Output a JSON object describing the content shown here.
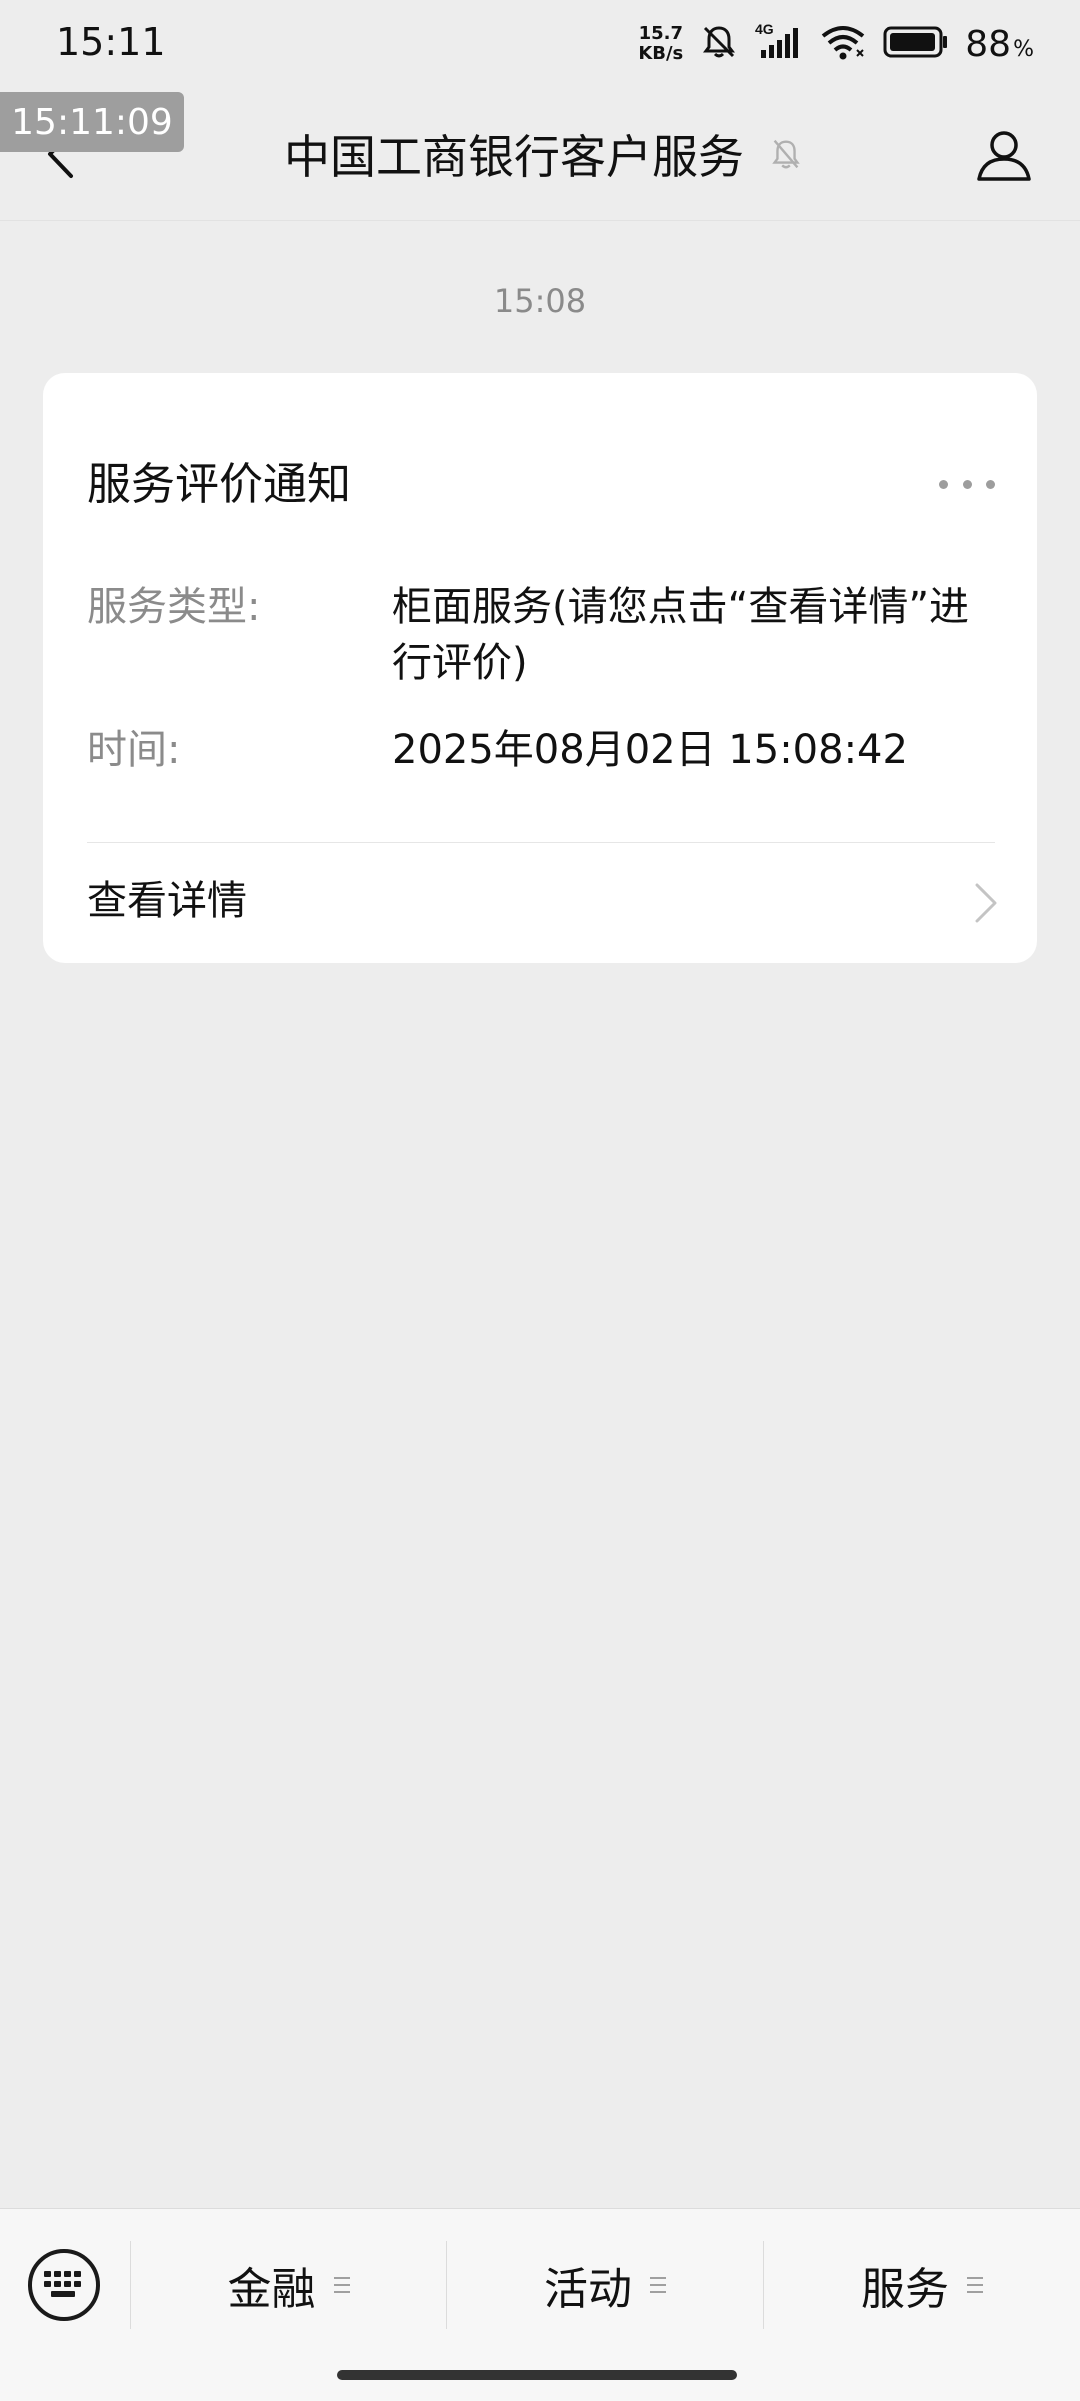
{
  "status_bar": {
    "time": "15:11",
    "net_speed_value": "15.7",
    "net_speed_unit": "KB/s",
    "network_type": "4G",
    "battery_percent": "88",
    "battery_unit": "%"
  },
  "overlay": {
    "timestamp": "15:11:09"
  },
  "header": {
    "title": "中国工商银行客户服务"
  },
  "conversation": {
    "message_time": "15:08",
    "card": {
      "title": "服务评价通知",
      "service_type_label": "服务类型:",
      "service_type_value": "柜面服务(请您点击“查看详情”进行评价)",
      "time_label": "时间:",
      "time_value": "2025年08月02日 15:08:42",
      "view_details_label": "查看详情"
    }
  },
  "bottom_menu": {
    "items": [
      {
        "label": "金融"
      },
      {
        "label": "活动"
      },
      {
        "label": "服务"
      }
    ]
  },
  "colors": {
    "page_background": "#ededed",
    "card_background": "#ffffff",
    "secondary_text": "#8b8b8b",
    "primary_text": "#111111"
  }
}
